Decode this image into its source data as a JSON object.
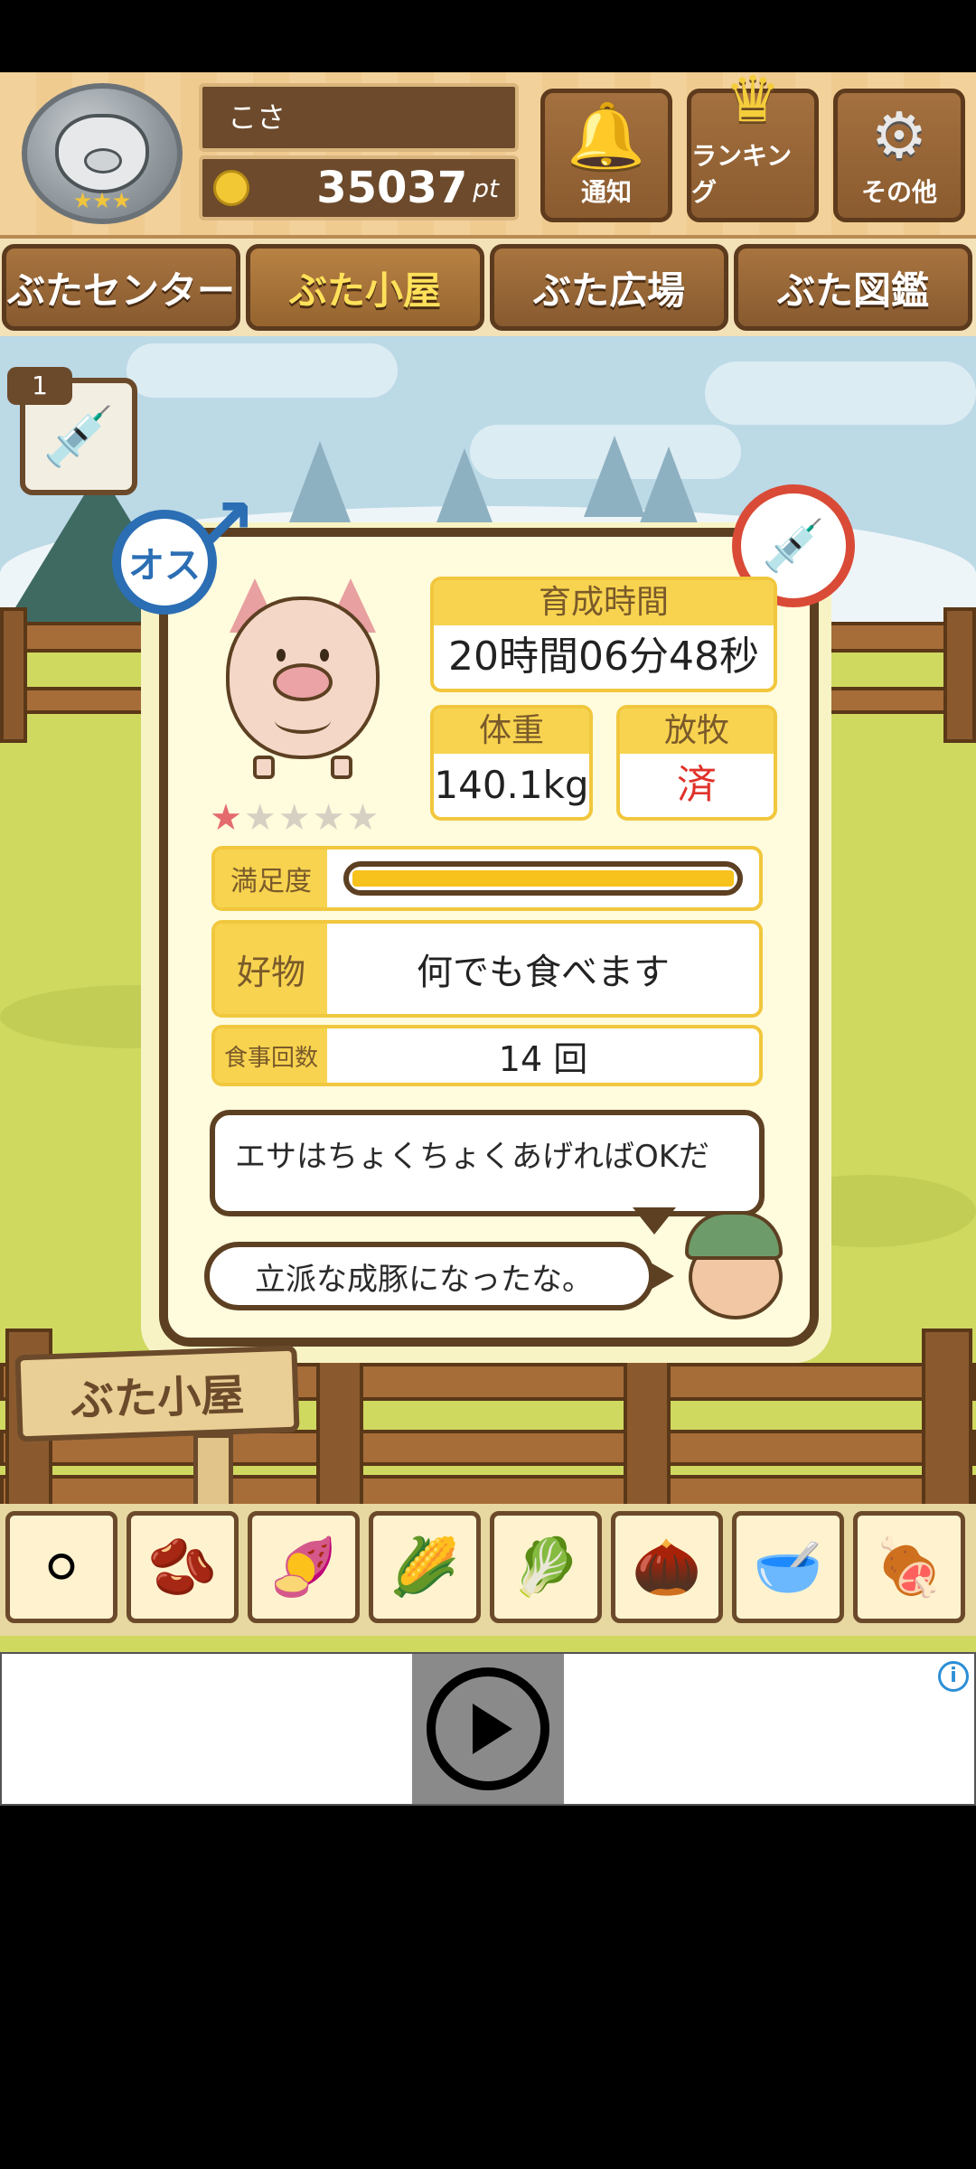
{
  "header": {
    "player_name": "こさ",
    "points": "35037",
    "points_unit": "pt",
    "buttons": [
      {
        "label": "通知",
        "icon": "bell-icon"
      },
      {
        "label": "ランキング",
        "icon": "crown-icon"
      },
      {
        "label": "その他",
        "icon": "gear-icon"
      }
    ]
  },
  "tabs": [
    {
      "label": "ぶたセンター"
    },
    {
      "label": "ぶた小屋",
      "active": true
    },
    {
      "label": "ぶた広場"
    },
    {
      "label": "ぶた図鑑"
    }
  ],
  "syringe_count": "1",
  "pig": {
    "sex_label": "オス",
    "rating_filled": 1,
    "rating_total": 5,
    "stats": {
      "growth_time_label": "育成時間",
      "growth_time_value": "20時間06分48秒",
      "weight_label": "体重",
      "weight_value": "140.1kg",
      "grazing_label": "放牧",
      "grazing_value": "済"
    },
    "satisfaction_label": "満足度",
    "satisfaction_level": 1.0,
    "favorite_label": "好物",
    "favorite_value": "何でも食べます",
    "meals_label": "食事回数",
    "meals_value": "14 回"
  },
  "dialogue": {
    "line1": "エサはちょくちょくあげればOKだ",
    "line2": "立派な成豚になったな。"
  },
  "signboard": "ぶた小屋",
  "food_items": [
    {
      "icon": "grain-pile-icon",
      "glyph": "⚪"
    },
    {
      "icon": "beans-icon",
      "glyph": "🫘"
    },
    {
      "icon": "sweet-potato-icon",
      "glyph": "🍠"
    },
    {
      "icon": "corn-icon",
      "glyph": "🌽"
    },
    {
      "icon": "greens-icon",
      "glyph": "🥬"
    },
    {
      "icon": "acorn-icon",
      "glyph": "🌰"
    },
    {
      "icon": "feed-bowl-icon",
      "glyph": "🥣"
    },
    {
      "icon": "meat-plate-icon",
      "glyph": "🍖"
    }
  ],
  "colors": {
    "wood": "#8a5b2f",
    "card_border": "#5d4022",
    "stat_header": "#f7d34f",
    "male_blue": "#2b6eb4",
    "no_inject_red": "#d94b37",
    "satisfaction_bar": "#f6c21b"
  }
}
